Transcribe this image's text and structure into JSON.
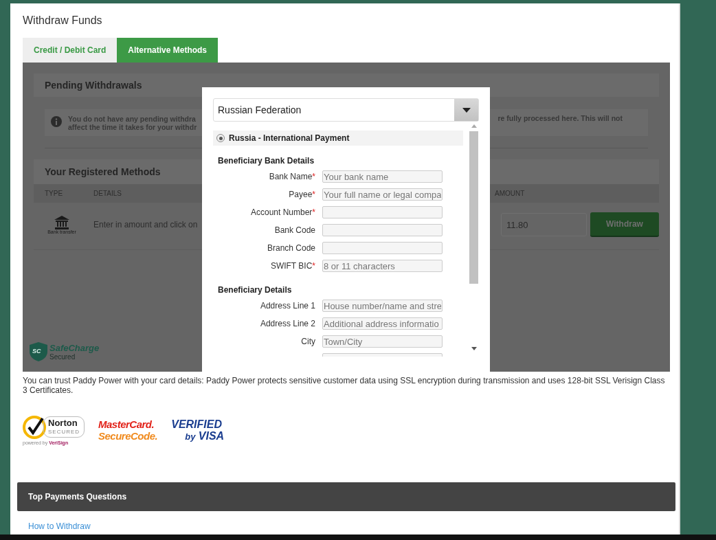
{
  "page": {
    "title": "Withdraw Funds"
  },
  "tabs": [
    {
      "label": "Credit / Debit Card",
      "selected": false
    },
    {
      "label": "Alternative Methods",
      "selected": true
    }
  ],
  "pending": {
    "title": "Pending Withdrawals",
    "info_left": [
      "You do not have any pending withdra",
      "affect the time it takes for your withdr"
    ],
    "info_right": "re fully processed here. This will not"
  },
  "methods": {
    "title": "Your Registered Methods",
    "columns": [
      "TYPE",
      "DETAILS",
      "AMOUNT"
    ],
    "rows": [
      {
        "type_label": "Bank transfer",
        "details": "Enter in amount and click on",
        "amount": "11.80",
        "button": "Withdraw"
      }
    ]
  },
  "safecharge": {
    "badge": "SC",
    "name": "SafeCharge",
    "tagline": "Secured"
  },
  "modal": {
    "country": "Russian Federation",
    "options": [
      {
        "label": "Russia - International Payment",
        "selected": true
      }
    ],
    "sections": [
      {
        "title": "Beneficiary Bank Details",
        "fields": [
          {
            "label": "Bank Name",
            "mark": "*",
            "placeholder": "Your bank name"
          },
          {
            "label": "Payee",
            "mark": "*",
            "placeholder": "Your full name or legal compa"
          },
          {
            "label": "Account Number",
            "mark": "*"
          },
          {
            "label": "Bank Code"
          },
          {
            "label": "Branch Code"
          },
          {
            "label": "SWIFT BIC",
            "mark": "*",
            "placeholder": "8 or 11 characters"
          }
        ]
      },
      {
        "title": "Beneficiary Details",
        "fields": [
          {
            "label": "Address Line 1",
            "placeholder": "House number/name and stre"
          },
          {
            "label": "Address Line 2",
            "placeholder": "Additional address informatio"
          },
          {
            "label": "City",
            "placeholder": "Town/City"
          },
          {
            "kind": "field"
          }
        ]
      }
    ]
  },
  "trust_text": "You can trust Paddy Power with your card details: Paddy Power protects sensitive customer data using SSL encryption during transmission and uses 128-bit SSL Verisign Class 3 Certificates.",
  "logos": {
    "norton": {
      "name": "Norton",
      "status": "SECURED",
      "powered_prefix": "powered by",
      "powered_brand": "VeriSign"
    },
    "mastercard": {
      "line1": "MasterCard.",
      "line2": "SecureCode."
    },
    "visa": {
      "line1": "VERIFIED",
      "line2_prefix": "by",
      "line2": "VISA"
    }
  },
  "faq": {
    "title": "Top Payments Questions",
    "links": [
      "How to Withdraw"
    ]
  }
}
